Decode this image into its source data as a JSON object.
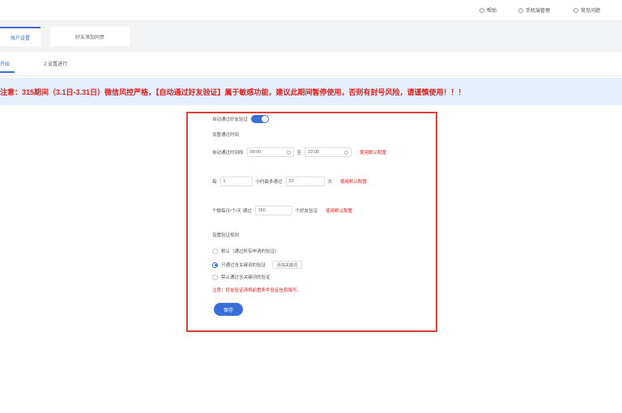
{
  "topbar": {
    "items": [
      {
        "icon": "help-icon",
        "label": "帮助"
      },
      {
        "icon": "phone-icon",
        "label": "手机端管理"
      },
      {
        "icon": "user-icon",
        "label": "常见问题"
      }
    ]
  },
  "tabs": [
    {
      "label": "账户设置"
    },
    {
      "label": "好友添加同意"
    }
  ],
  "steps": [
    {
      "label": "开始"
    },
    {
      "label": "2  设置进行"
    }
  ],
  "notice": "注意：315期间（3.1日-3.31日）微信风控严格，【自动通过好友验证】属于敏感功能，建议此期间暂停使用，否则有封号风险，请谨慎使用！！！",
  "form": {
    "toggle_label": "自动通过好友验证",
    "toggle_on": true,
    "section_time": "设置通过时间",
    "time_label": "自动通过时间段",
    "time_start": "08:00",
    "time_sep": "至",
    "time_end": "22:00",
    "time_warn": "使用默认配置",
    "rate_prefix": "每",
    "rate_hours": "1",
    "rate_mid": "小时最多通过",
    "rate_count": "20",
    "rate_unit": "次",
    "rate_warn": "使用默认配置",
    "daily_label": "个微每日/个/天 通过",
    "daily_count": "150",
    "daily_unit": "个好友验证",
    "daily_warn": "使用默认配置",
    "section_rule": "设置验证规则",
    "options": [
      {
        "label": "默认（通过所有申请的验证）",
        "selected": false
      },
      {
        "label": "只通过含关键词的验证",
        "selected": true,
        "button": "添加关键词"
      },
      {
        "label": "禁止通过含关键词的验证",
        "selected": false
      }
    ],
    "note": "注意：好友验证请将前置条件验证信息填写。",
    "save_label": "保存"
  },
  "colors": {
    "accent": "#3a6fd8",
    "warning": "#e02020",
    "notice_bg": "#e6f0fb",
    "highlight_border": "#e0403a"
  }
}
